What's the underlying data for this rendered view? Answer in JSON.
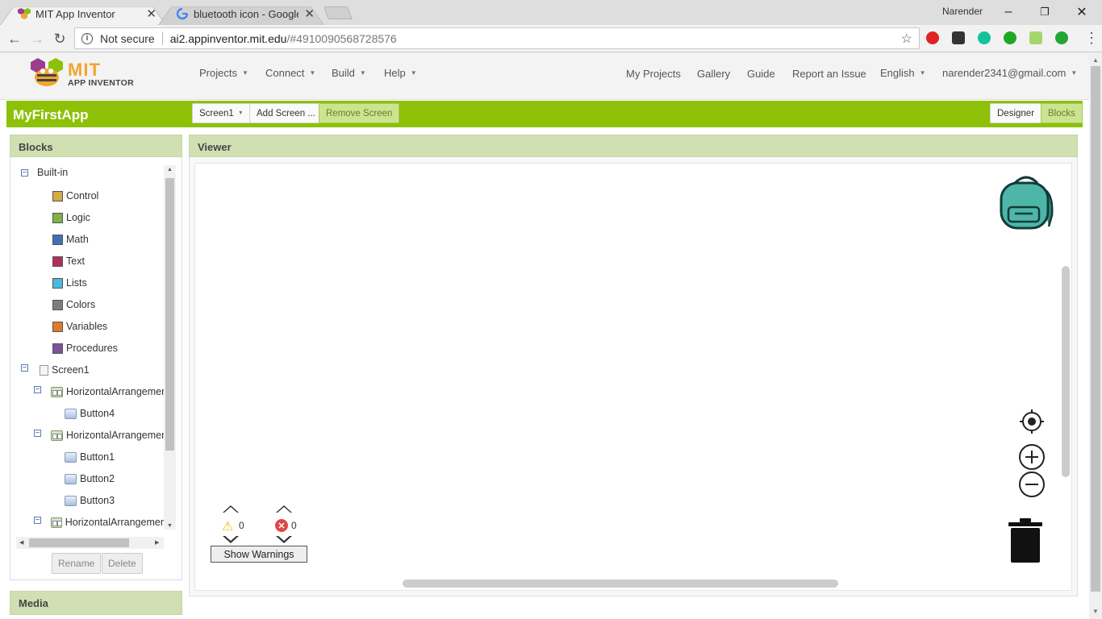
{
  "browser": {
    "tabs": [
      {
        "title": "MIT App Inventor",
        "close": "✕"
      },
      {
        "title": "bluetooth icon - Google",
        "close": "✕"
      }
    ],
    "profile": "Narender",
    "window_controls": {
      "minimize": "–",
      "restore": "❐",
      "close": "✕"
    },
    "omnibox": {
      "security_label": "Not secure",
      "url_host": "ai2.appinventor.mit.edu",
      "url_path": "/#4910090568728576"
    }
  },
  "app": {
    "logo": {
      "line1": "MIT",
      "line2": "APP INVENTOR"
    },
    "menus": [
      {
        "label": "Projects"
      },
      {
        "label": "Connect"
      },
      {
        "label": "Build"
      },
      {
        "label": "Help"
      }
    ],
    "links": [
      {
        "label": "My Projects"
      },
      {
        "label": "Gallery"
      },
      {
        "label": "Guide"
      },
      {
        "label": "Report an Issue"
      }
    ],
    "language": "English",
    "account": "narender2341@gmail.com",
    "project_name": "MyFirstApp",
    "screen_select": "Screen1",
    "add_screen": "Add Screen ...",
    "remove_screen": "Remove Screen",
    "designer_btn": "Designer",
    "blocks_btn": "Blocks"
  },
  "blocks_panel": {
    "title": "Blocks",
    "builtin_label": "Built-in",
    "builtin": [
      {
        "label": "Control",
        "color": "#d6ab45"
      },
      {
        "label": "Logic",
        "color": "#7cb342"
      },
      {
        "label": "Math",
        "color": "#3f71b5"
      },
      {
        "label": "Text",
        "color": "#b32d5e"
      },
      {
        "label": "Lists",
        "color": "#4cb7e0"
      },
      {
        "label": "Colors",
        "color": "#7d7d7d"
      },
      {
        "label": "Variables",
        "color": "#e07a2c"
      },
      {
        "label": "Procedures",
        "color": "#7c5296"
      }
    ],
    "screen_label": "Screen1",
    "components": [
      {
        "label": "HorizontalArrangemer",
        "kind": "arrangement"
      },
      {
        "label": "Button4",
        "kind": "button"
      },
      {
        "label": "HorizontalArrangemer",
        "kind": "arrangement"
      },
      {
        "label": "Button1",
        "kind": "button"
      },
      {
        "label": "Button2",
        "kind": "button"
      },
      {
        "label": "Button3",
        "kind": "button"
      },
      {
        "label": "HorizontalArrangemer",
        "kind": "arrangement"
      }
    ],
    "rename": "Rename",
    "delete": "Delete"
  },
  "media_panel": {
    "title": "Media"
  },
  "viewer": {
    "title": "Viewer",
    "warning_count": "0",
    "error_count": "0",
    "show_warnings": "Show Warnings"
  },
  "colors": {
    "accent_green": "#8dc007",
    "panel_header": "#d1e0b3",
    "backpack": "#4db6a8"
  }
}
